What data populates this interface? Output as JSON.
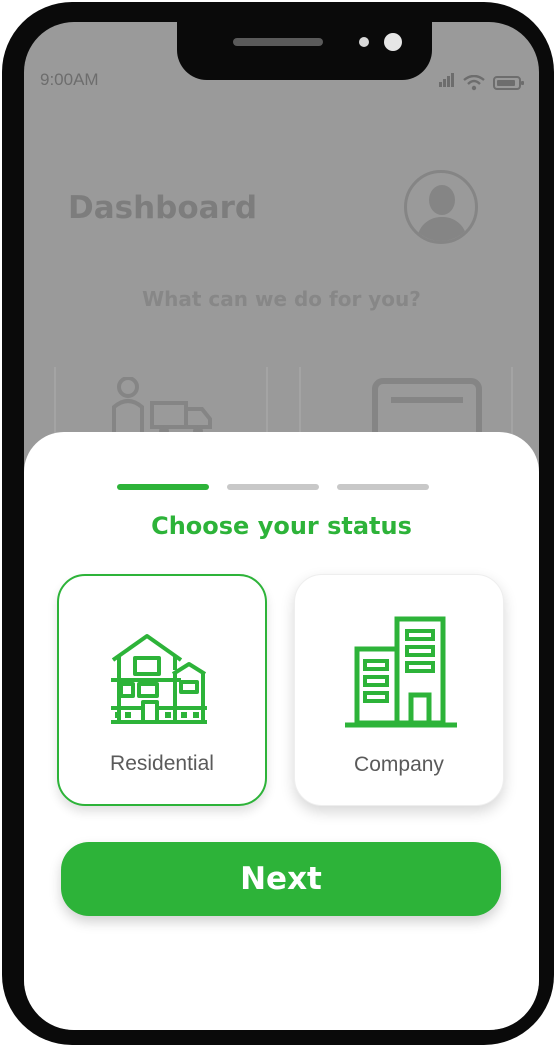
{
  "status_bar": {
    "time": "9:00AM",
    "icons": [
      "signal-icon",
      "wifi-icon",
      "battery-icon"
    ]
  },
  "dashboard": {
    "title": "Dashboard",
    "subtitle": "What can we do for you?",
    "avatar_icon": "user-avatar-icon",
    "services": [
      {
        "icon": "delivery-truck-icon"
      },
      {
        "icon": "credit-card-icon"
      }
    ]
  },
  "sheet": {
    "steps_total": 3,
    "step_current": 1,
    "title": "Choose your status",
    "options": [
      {
        "label": "Residential",
        "icon": "house-icon",
        "selected": true
      },
      {
        "label": "Company",
        "icon": "buildings-icon",
        "selected": false
      }
    ],
    "next_label": "Next"
  },
  "colors": {
    "accent": "#2db339",
    "overlay": "#9a9a9a",
    "step_inactive": "#c8c8c8",
    "label": "#5a5a5a"
  }
}
